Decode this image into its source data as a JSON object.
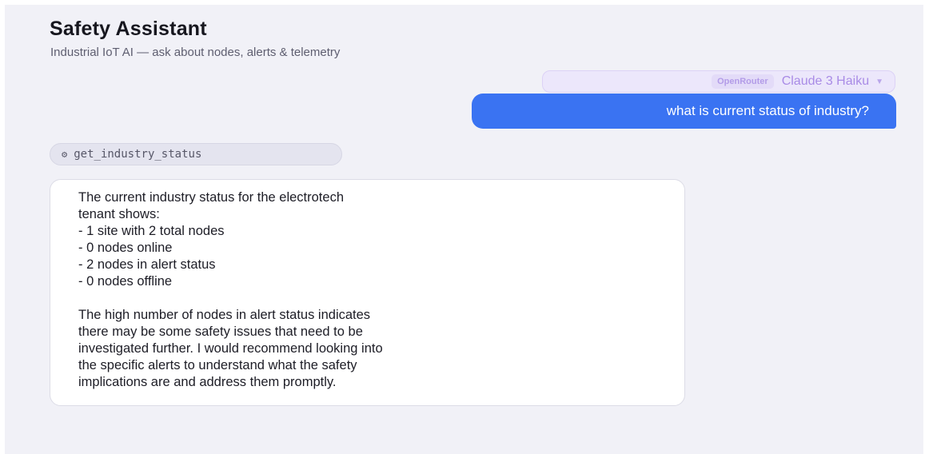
{
  "header": {
    "title": "Safety Assistant",
    "subtitle": "Industrial IoT AI — ask about nodes, alerts & telemetry"
  },
  "model_selector": {
    "provider": "OpenRouter",
    "model": "Claude 3 Haiku",
    "icon": "chevron-down-icon"
  },
  "chat": {
    "user_message": "what is current status of industry?",
    "tool_call": {
      "icon": "gear-icon",
      "label": "get_industry_status"
    },
    "assistant_lines": [
      "The current industry status for the electrotech",
      "tenant shows:",
      "- 1 site with 2 total nodes",
      "- 0 nodes online",
      "- 2 nodes in alert status",
      "- 0 nodes offline"
    ],
    "assistant_paragraph_lines": [
      "The high number of nodes in alert status indicates",
      "there may be some safety issues that need to be",
      "investigated further. I would recommend looking into",
      "the specific alerts to understand what the safety",
      "implications are and address them promptly."
    ]
  },
  "colors": {
    "user_bubble": "#3a73f2",
    "accent_purple": "#a98be6",
    "background": "#f1f1f7"
  }
}
